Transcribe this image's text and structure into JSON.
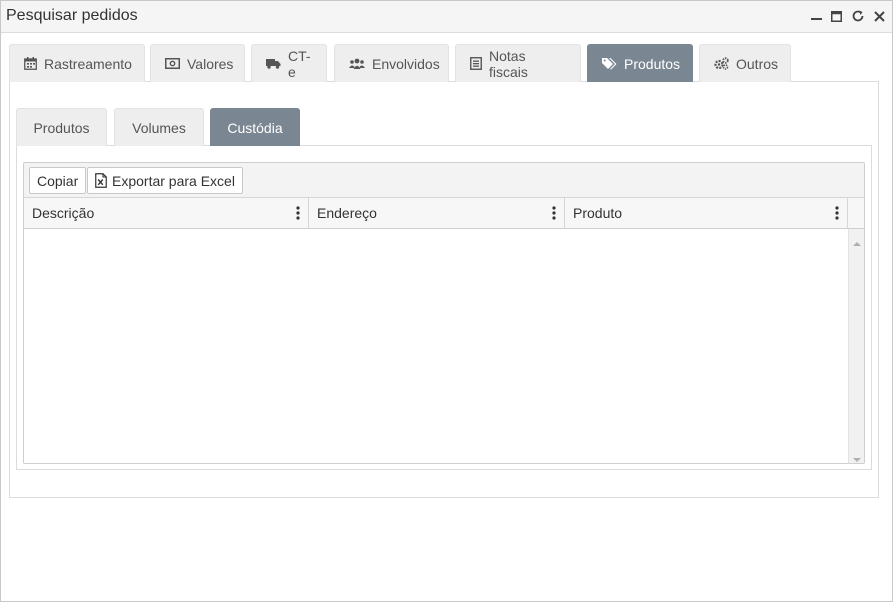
{
  "window": {
    "title": "Pesquisar pedidos",
    "controls": [
      "minimize-icon",
      "maximize-icon",
      "refresh-icon",
      "close-icon"
    ]
  },
  "tabs": [
    {
      "label": "Rastreamento",
      "icon": "calendar-icon",
      "active": false
    },
    {
      "label": "Valores",
      "icon": "money-icon",
      "active": false
    },
    {
      "label": "CT-e",
      "icon": "truck-icon",
      "active": false
    },
    {
      "label": "Envolvidos",
      "icon": "users-icon",
      "active": false
    },
    {
      "label": "Notas fiscais",
      "icon": "document-list-icon",
      "active": false
    },
    {
      "label": "Produtos",
      "icon": "tags-icon",
      "active": true
    },
    {
      "label": "Outros",
      "icon": "gears-icon",
      "active": false
    }
  ],
  "subtabs": [
    {
      "label": "Produtos",
      "active": false
    },
    {
      "label": "Volumes",
      "active": false
    },
    {
      "label": "Custódia",
      "active": true
    }
  ],
  "toolbar": {
    "copy_label": "Copiar",
    "export_label": "Exportar para Excel"
  },
  "grid": {
    "columns": [
      "Descrição",
      "Endereço",
      "Produto"
    ],
    "rows": []
  },
  "colors": {
    "active_tab": "#7a8792",
    "inactive_tab": "#eeeeee"
  }
}
